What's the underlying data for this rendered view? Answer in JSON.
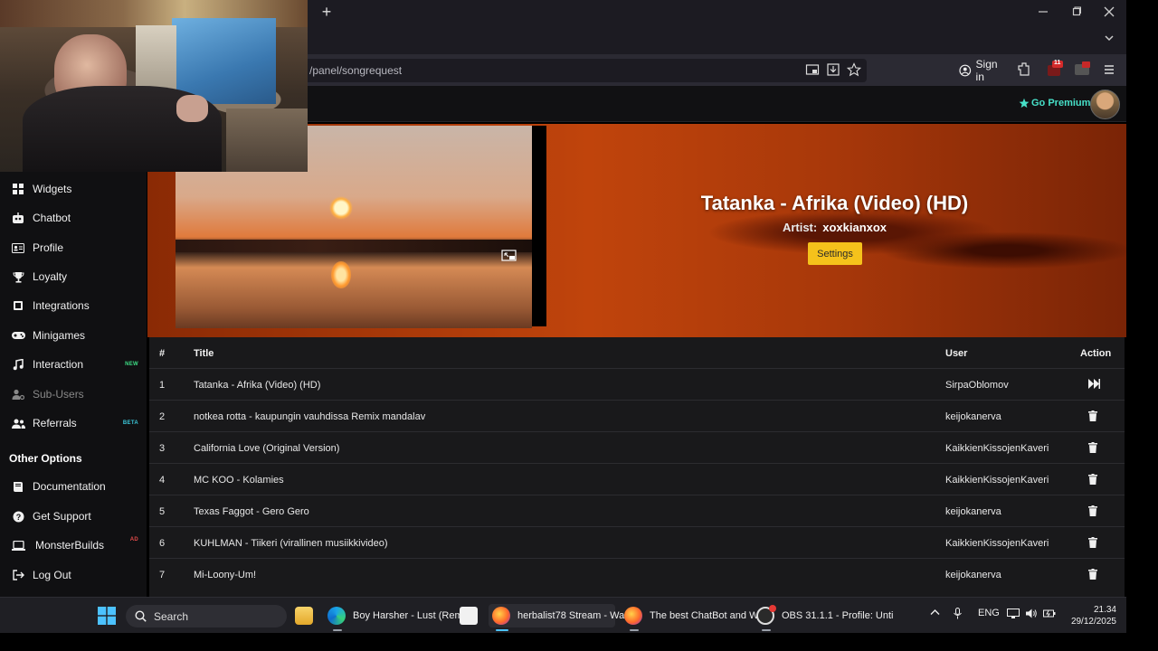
{
  "browser": {
    "new_tab_label": "+",
    "url": "/panel/songrequest",
    "sign_in": "Sign in",
    "window_controls": [
      "minimize",
      "restore",
      "close"
    ],
    "badge_count": "11"
  },
  "header": {
    "premium_label": "Go Premium"
  },
  "sidebar": {
    "items": [
      {
        "label": "Widgets",
        "icon": "widgets-icon"
      },
      {
        "label": "Chatbot",
        "icon": "robot-icon"
      },
      {
        "label": "Profile",
        "icon": "id-card-icon"
      },
      {
        "label": "Loyalty",
        "icon": "trophy-icon"
      },
      {
        "label": "Integrations",
        "icon": "plug-icon"
      },
      {
        "label": "Minigames",
        "icon": "gamepad-icon"
      },
      {
        "label": "Interaction",
        "icon": "music-icon",
        "badge": "NEW"
      },
      {
        "label": "Sub-Users",
        "icon": "user-gear-icon"
      },
      {
        "label": "Referrals",
        "icon": "users-icon",
        "badge": "BETA"
      }
    ],
    "section_title": "Other Options",
    "other_items": [
      {
        "label": "Documentation",
        "icon": "book-icon"
      },
      {
        "label": "Get Support",
        "icon": "question-icon"
      },
      {
        "label": "MonsterBuilds",
        "icon": "laptop-icon",
        "badge": "AD"
      },
      {
        "label": "Log Out",
        "icon": "logout-icon"
      }
    ]
  },
  "now_playing": {
    "title": "Tatanka - Afrika (Video) (HD)",
    "artist_label": "Artist:",
    "artist": "xoxkianxox",
    "settings_label": "Settings"
  },
  "table": {
    "headers": {
      "num": "#",
      "title": "Title",
      "user": "User",
      "action": "Action"
    },
    "rows": [
      {
        "num": "1",
        "title": "Tatanka - Afrika (Video) (HD)",
        "user": "SirpaOblomov",
        "action": "skip"
      },
      {
        "num": "2",
        "title": "notkea rotta - kaupungin vauhdissa Remix mandalav",
        "user": "keijokanerva",
        "action": "delete"
      },
      {
        "num": "3",
        "title": "California Love (Original Version)",
        "user": "KaikkienKissojenKaveri",
        "action": "delete"
      },
      {
        "num": "4",
        "title": "MC KOO - Kolamies",
        "user": "KaikkienKissojenKaveri",
        "action": "delete"
      },
      {
        "num": "5",
        "title": "Texas Faggot - Gero Gero",
        "user": "keijokanerva",
        "action": "delete"
      },
      {
        "num": "6",
        "title": "KUHLMAN - Tiikeri (virallinen musiikkivideo)",
        "user": "KaikkienKissojenKaveri",
        "action": "delete"
      },
      {
        "num": "7",
        "title": "Mi-Loony-Um!",
        "user": "keijokanerva",
        "action": "delete"
      }
    ]
  },
  "taskbar": {
    "search_label": "Search",
    "apps": [
      {
        "label": "Boy Harsher - Lust (Rem"
      },
      {
        "label": "herbalist78 Stream - Wa"
      },
      {
        "label": "The best ChatBot and W"
      },
      {
        "label": "OBS 31.1.1 - Profile: Unti"
      }
    ],
    "language": "ENG",
    "time": "21.34",
    "date": "29/12/2025"
  },
  "colors": {
    "accent_teal": "#47e0c8",
    "settings_yellow": "#f5c21b",
    "badge_new": "#3ddc84",
    "badge_beta": "#3bc7d9",
    "badge_ad": "#e14a4a"
  }
}
